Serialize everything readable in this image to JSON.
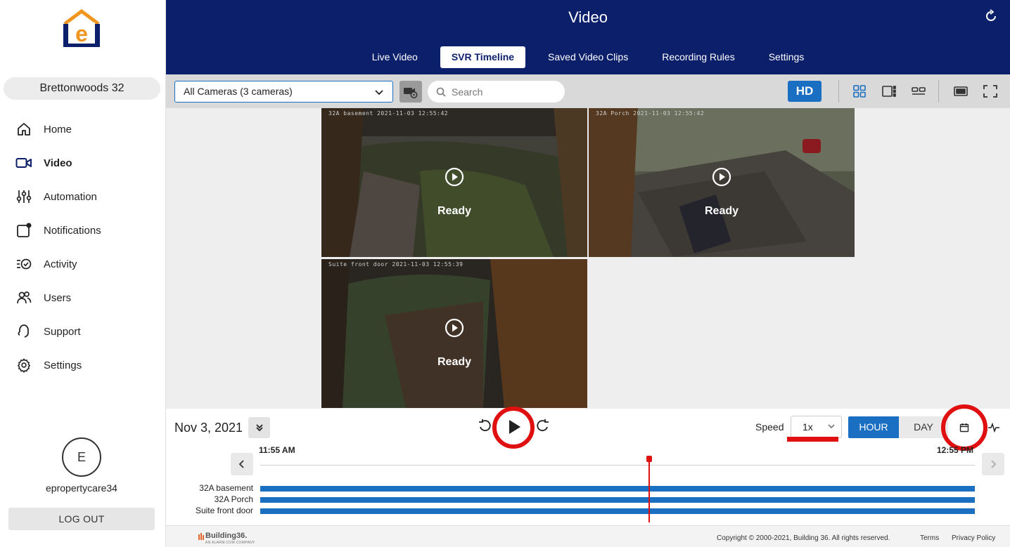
{
  "sidebar": {
    "site_name": "Brettonwoods 32",
    "items": [
      {
        "label": "Home",
        "icon": "home-icon"
      },
      {
        "label": "Video",
        "icon": "video-camera-icon",
        "active": true
      },
      {
        "label": "Automation",
        "icon": "sliders-icon"
      },
      {
        "label": "Notifications",
        "icon": "notification-icon"
      },
      {
        "label": "Activity",
        "icon": "activity-list-icon"
      },
      {
        "label": "Users",
        "icon": "users-icon"
      },
      {
        "label": "Support",
        "icon": "headset-icon"
      },
      {
        "label": "Settings",
        "icon": "gear-icon"
      }
    ],
    "avatar_initial": "E",
    "username": "epropertycare34",
    "logout_label": "LOG OUT"
  },
  "header": {
    "title": "Video",
    "tabs": [
      {
        "label": "Live Video"
      },
      {
        "label": "SVR Timeline",
        "active": true
      },
      {
        "label": "Saved Video Clips"
      },
      {
        "label": "Recording Rules"
      },
      {
        "label": "Settings"
      }
    ]
  },
  "toolbar": {
    "camera_select": "All Cameras (3 cameras)",
    "search_placeholder": "Search",
    "hd_label": "HD"
  },
  "cameras": [
    {
      "name": "32A basement",
      "timestamp": "32A basement 2021-11-03 12:55:42",
      "status": "Ready"
    },
    {
      "name": "32A Porch",
      "timestamp": "32A Porch 2021-11-03 12:55:42",
      "status": "Ready"
    },
    {
      "name": "Suite front door",
      "timestamp": "Suite front door 2021-11-03 12:55:39",
      "status": "Ready"
    }
  ],
  "timeline": {
    "date": "Nov 3, 2021",
    "speed_label": "Speed",
    "speed_value": "1x",
    "hour_label": "HOUR",
    "day_label": "DAY",
    "start_time": "11:55 AM",
    "end_time": "12:55 PM",
    "tracks": [
      "32A basement",
      "32A Porch",
      "Suite front door"
    ]
  },
  "footer": {
    "brand": "Building36.",
    "brand_sub": "AN ALARM.COM COMPANY",
    "copyright": "Copyright © 2000-2021, Building 36. All rights reserved.",
    "terms": "Terms",
    "privacy": "Privacy Policy"
  },
  "colors": {
    "header_bg": "#0b1f6b",
    "accent": "#1a6fc2",
    "highlight_red": "#e01010",
    "logo_orange": "#f0961e"
  }
}
